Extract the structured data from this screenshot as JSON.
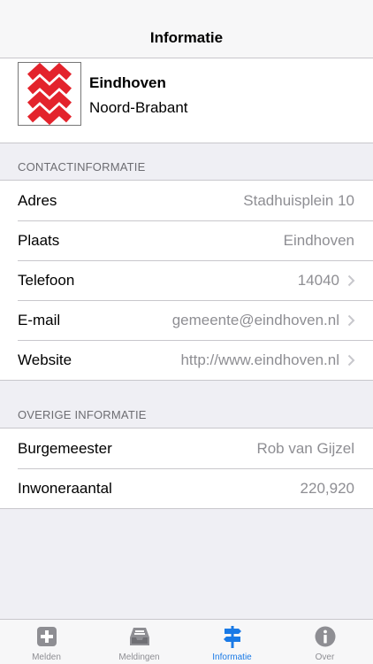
{
  "navbar": {
    "title": "Informatie"
  },
  "header": {
    "city": "Eindhoven",
    "province": "Noord-Brabant"
  },
  "contact": {
    "section_title": "CONTACTINFORMATIE",
    "rows": [
      {
        "label": "Adres",
        "value": "Stadhuisplein 10"
      },
      {
        "label": "Plaats",
        "value": "Eindhoven"
      },
      {
        "label": "Telefoon",
        "value": "14040"
      },
      {
        "label": "E-mail",
        "value": "gemeente@eindhoven.nl"
      },
      {
        "label": "Website",
        "value": "http://www.eindhoven.nl"
      }
    ]
  },
  "other": {
    "section_title": "OVERIGE INFORMATIE",
    "rows": [
      {
        "label": "Burgemeester",
        "value": "Rob van Gijzel"
      },
      {
        "label": "Inwoneraantal",
        "value": "220,920"
      }
    ]
  },
  "tabs": [
    {
      "label": "Melden",
      "icon": "plus-box-icon"
    },
    {
      "label": "Meldingen",
      "icon": "inbox-tray-icon"
    },
    {
      "label": "Informatie",
      "icon": "signpost-icon",
      "active": true
    },
    {
      "label": "Over",
      "icon": "info-circle-icon"
    }
  ],
  "colors": {
    "accent": "#1a7ae6",
    "logo_red": "#e3232c",
    "secondary_text": "#8e8e93",
    "background": "#efeff4"
  }
}
